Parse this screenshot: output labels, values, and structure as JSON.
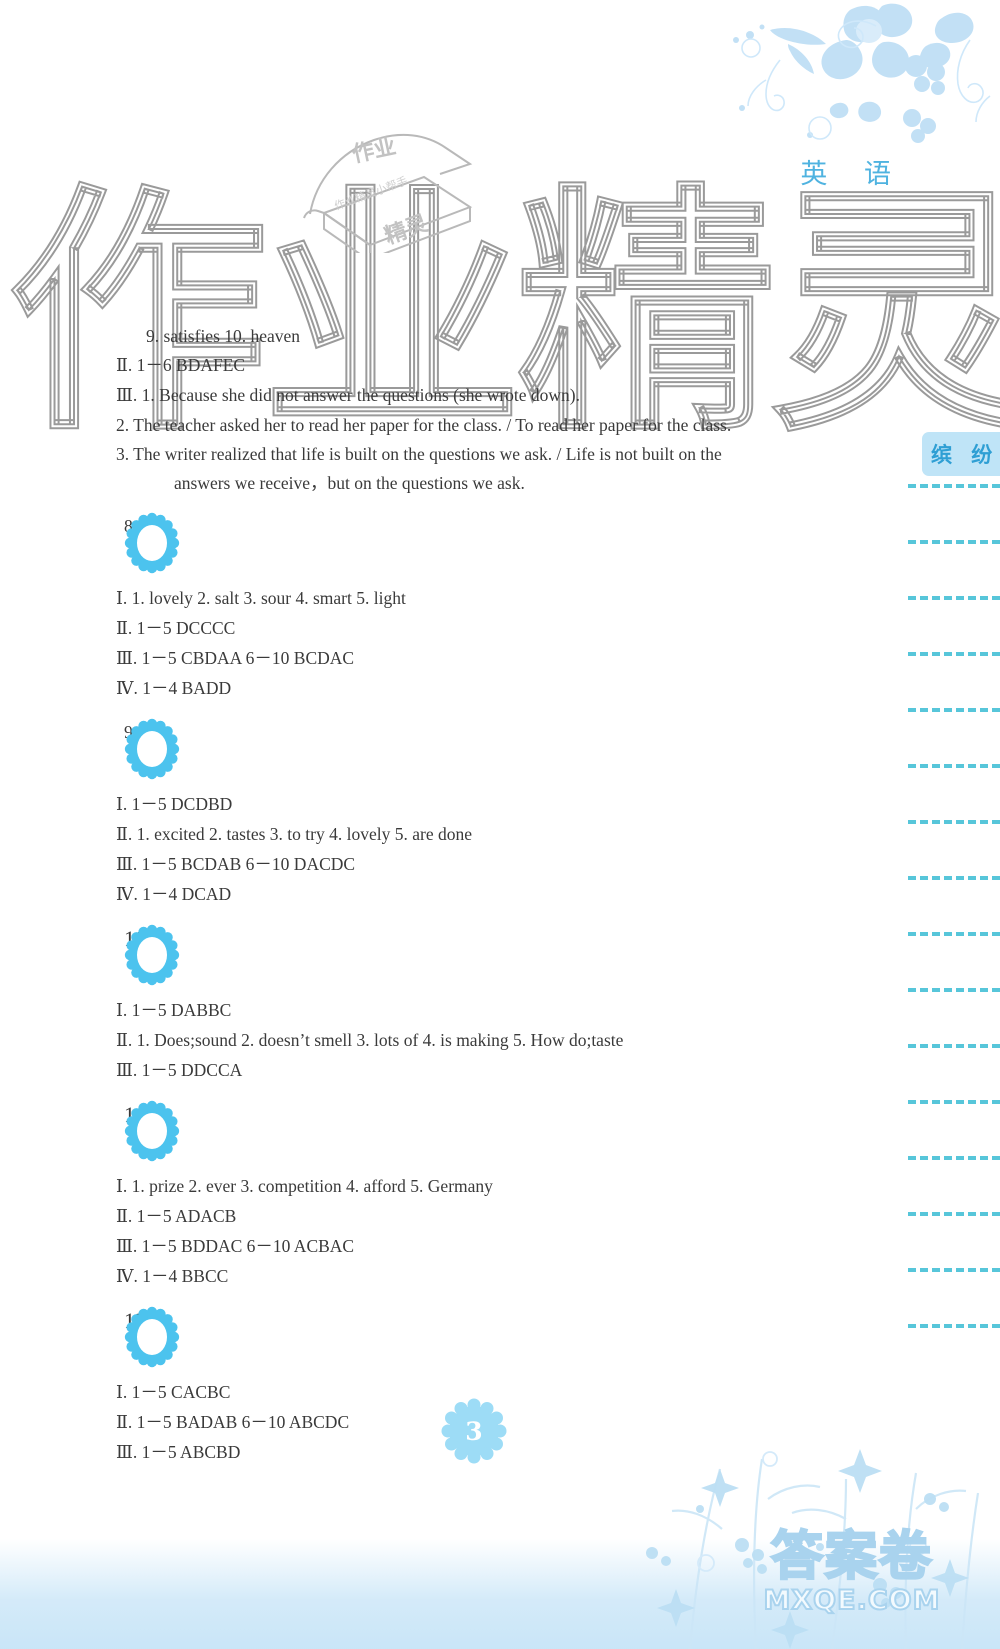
{
  "page": {
    "subject_title": "英 语",
    "page_number": "3",
    "side_tab_label": "缤 纷",
    "watermark_big": [
      "作",
      "业",
      "精",
      "灵"
    ],
    "watermark_logo_lines": [
      "作业",
      "精灵"
    ],
    "watermark_site_cn": "答案卷",
    "watermark_site_en": "MXQE.COM"
  },
  "continued": {
    "lines": [
      {
        "text": "9. satisfies   10. heaven",
        "indent": 1
      },
      {
        "roman": "Ⅱ",
        "text": ". 1－6 BDAFEC",
        "indent": 0
      },
      {
        "roman": "Ⅲ",
        "text": ". 1. Because she did not answer the questions (she wrote down).",
        "indent": 0
      },
      {
        "text": "2. The teacher asked her to read her paper for the class. / To read her paper for the class.",
        "indent": 0
      },
      {
        "text": "3. The writer realized that life is built on the questions we ask.  /  Life is not built on the",
        "indent": 0
      },
      {
        "text": "answers we receive，but on the questions we ask.",
        "indent": 2
      }
    ]
  },
  "sections": [
    {
      "number": "8",
      "lines": [
        {
          "roman": "Ⅰ",
          "text": ". 1. lovely   2. salt   3. sour   4. smart   5. light"
        },
        {
          "roman": "Ⅱ",
          "text": ". 1－5 DCCCC"
        },
        {
          "roman": "Ⅲ",
          "text": ". 1－5 CBDAA   6－10 BCDAC"
        },
        {
          "roman": "Ⅳ",
          "text": ". 1－4 BADD"
        }
      ]
    },
    {
      "number": "9",
      "lines": [
        {
          "roman": "Ⅰ",
          "text": ". 1－5 DCDBD"
        },
        {
          "roman": "Ⅱ",
          "text": ". 1. excited   2. tastes   3. to try   4. lovely   5. are done"
        },
        {
          "roman": "Ⅲ",
          "text": ". 1－5 BCDAB   6－10 DACDC"
        },
        {
          "roman": "Ⅳ",
          "text": ". 1－4 DCAD"
        }
      ]
    },
    {
      "number": "10",
      "lines": [
        {
          "roman": "Ⅰ",
          "text": ". 1－5 DABBC"
        },
        {
          "roman": "Ⅱ",
          "text": ". 1. Does;sound   2. doesn’t smell   3. lots of   4. is making   5. How do;taste"
        },
        {
          "roman": "Ⅲ",
          "text": ". 1－5 DDCCA"
        }
      ]
    },
    {
      "number": "11",
      "lines": [
        {
          "roman": "Ⅰ",
          "text": ". 1. prize   2. ever   3. competition   4. afford   5. Germany"
        },
        {
          "roman": "Ⅱ",
          "text": ". 1－5 ADACB"
        },
        {
          "roman": "Ⅲ",
          "text": ". 1－5 BDDAC   6－10 ACBAC"
        },
        {
          "roman": "Ⅳ",
          "text": ". 1－4 BBCC"
        }
      ]
    },
    {
      "number": "12",
      "lines": [
        {
          "roman": "Ⅰ",
          "text": ". 1－5 CACBC"
        },
        {
          "roman": "Ⅱ",
          "text": ". 1－5 BADAB   6－10 ABCDC"
        },
        {
          "roman": "Ⅲ",
          "text": ". 1－5 ABCBD"
        }
      ]
    }
  ],
  "colors": {
    "accent": "#2aa3d8",
    "badge_fill": "#4cc3ee",
    "tab_fill": "#bfe4f7",
    "rule_dash": "#4fc3d9",
    "text": "#3a3a3a"
  }
}
